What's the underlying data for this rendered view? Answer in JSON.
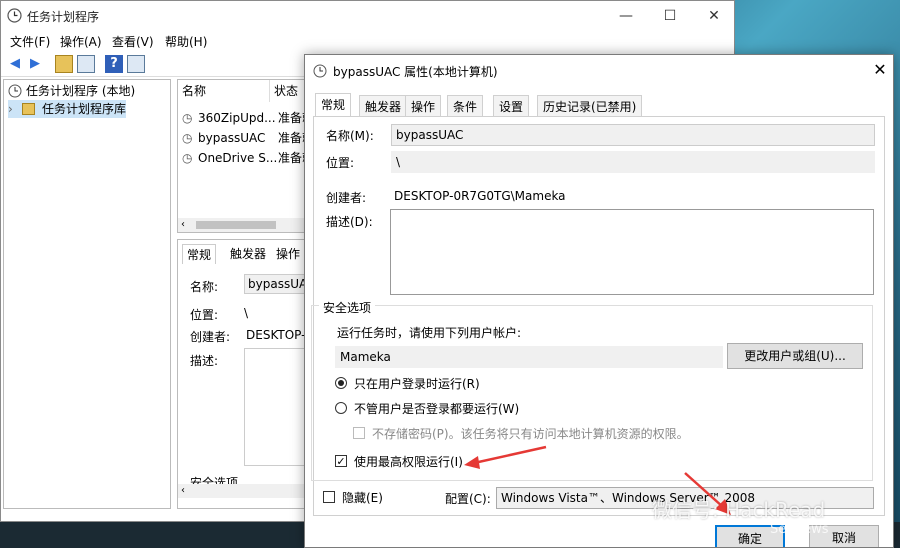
{
  "main_window": {
    "title": "任务计划程序",
    "controls": {
      "minimize": "—",
      "maximize": "☐",
      "close": "✕"
    },
    "menu": [
      "文件(F)",
      "操作(A)",
      "查看(V)",
      "帮助(H)"
    ],
    "tree": {
      "root": "任务计划程序 (本地)",
      "child": "任务计划程序库"
    },
    "list": {
      "columns": [
        "名称",
        "状态"
      ],
      "rows": [
        {
          "name": "360ZipUpd...",
          "status": "准备就"
        },
        {
          "name": "bypassUAC",
          "status": "准备就"
        },
        {
          "name": "OneDrive S...",
          "status": "准备就"
        }
      ]
    },
    "detail": {
      "tabs": [
        "常规",
        "触发器",
        "操作"
      ],
      "name_label": "名称:",
      "name_value": "bypassUAC",
      "location_label": "位置:",
      "location_value": "\\",
      "author_label": "创建者:",
      "author_value": "DESKTOP-(",
      "desc_label": "描述:",
      "security_label": "安全选项"
    }
  },
  "dialog": {
    "title": "bypassUAC 属性(本地计算机)",
    "close": "✕",
    "tabs": [
      "常规",
      "触发器",
      "操作",
      "条件",
      "设置",
      "历史记录(已禁用)"
    ],
    "active_tab": "常规",
    "name_label": "名称(M):",
    "name_value": "bypassUAC",
    "location_label": "位置:",
    "location_value": "\\",
    "author_label": "创建者:",
    "author_value": "DESKTOP-0R7G0TG\\Mameka",
    "desc_label": "描述(D):",
    "security": {
      "legend": "安全选项",
      "run_as_prompt": "运行任务时，请使用下列用户帐户:",
      "user": "Mameka",
      "change_user_button": "更改用户或组(U)...",
      "radio_logged_on": "只在用户登录时运行(R)",
      "radio_whether": "不管用户是否登录都要运行(W)",
      "no_store_password": "不存储密码(P)。该任务将只有访问本地计算机资源的权限。",
      "highest_privileges": "使用最高权限运行(I)"
    },
    "hidden_label": "隐藏(E)",
    "config_label": "配置(C):",
    "config_value": "Windows Vista™、Windows Server™ 2008",
    "ok_button": "确定",
    "cancel_button": "取消"
  },
  "watermark": "微信号: HackRead",
  "watermark_sub": "SecNews",
  "colors": {
    "arrow": "#e53935",
    "titlebar_text": "#222222"
  }
}
